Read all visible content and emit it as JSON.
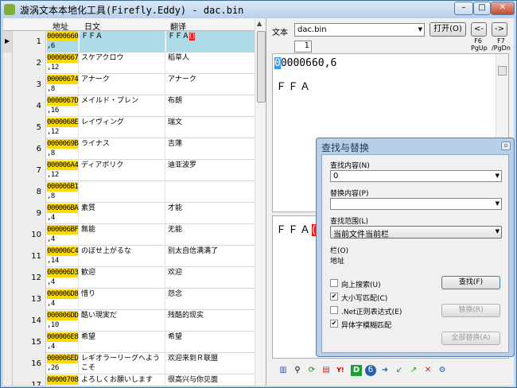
{
  "window": {
    "title": "漩涡文本本地化工具(Firefly.Eddy) - dac.bin",
    "minimize": "–",
    "maximize": "□",
    "close": "✕"
  },
  "grid": {
    "headers": {
      "address": "地址",
      "japanese": "日文",
      "translation": "翻译"
    },
    "rows": [
      {
        "num": "1",
        "addr": "00000660",
        "len": ",6",
        "jp": "ＦＦＡ",
        "cn": "ＦＦＡ",
        "cn_hl": "()"
      },
      {
        "num": "2",
        "addr": "00000667",
        "len": ",12",
        "jp": "スケアクロウ",
        "cn": "稻草人",
        "cn_hl": ""
      },
      {
        "num": "3",
        "addr": "00000674",
        "len": ",8",
        "jp": "アナーク",
        "cn": "アナーク",
        "cn_hl": ""
      },
      {
        "num": "4",
        "addr": "0000067D",
        "len": ",16",
        "jp": "メイルド・プレン",
        "cn": "布朗",
        "cn_hl": ""
      },
      {
        "num": "5",
        "addr": "0000068E",
        "len": ",12",
        "jp": "レイヴィング",
        "cn": "瑞文",
        "cn_hl": ""
      },
      {
        "num": "6",
        "addr": "0000069B",
        "len": ",8",
        "jp": "ライナス",
        "cn": "吉蓮",
        "cn_hl": ""
      },
      {
        "num": "7",
        "addr": "000006A4",
        "len": ",12",
        "jp": "ディアボリク",
        "cn": "迪亚波罗",
        "cn_hl": ""
      },
      {
        "num": "8",
        "addr": "000006B1",
        "len": ",8",
        "jp": "",
        "cn": "",
        "cn_hl": ""
      },
      {
        "num": "9",
        "addr": "000006BA",
        "len": ",4",
        "jp": "素質",
        "cn": "才能",
        "cn_hl": ""
      },
      {
        "num": "10",
        "addr": "000006BF",
        "len": ",4",
        "jp": "無能",
        "cn": "无能",
        "cn_hl": ""
      },
      {
        "num": "11",
        "addr": "000006C4",
        "len": ",14",
        "jp": "のぼせ上がるな",
        "cn": "别太自信满满了",
        "cn_hl": ""
      },
      {
        "num": "12",
        "addr": "000006D3",
        "len": ",4",
        "jp": "歓迎",
        "cn": "欢迎",
        "cn_hl": ""
      },
      {
        "num": "13",
        "addr": "000006D8",
        "len": ",4",
        "jp": "惜り",
        "cn": "怨念",
        "cn_hl": ""
      },
      {
        "num": "14",
        "addr": "000006DD",
        "len": ",10",
        "jp": "酷い現実だ",
        "cn": "残酷的现实",
        "cn_hl": ""
      },
      {
        "num": "15",
        "addr": "000006E8",
        "len": ",4",
        "jp": "希望",
        "cn": "希望",
        "cn_hl": ""
      },
      {
        "num": "16",
        "addr": "000006ED",
        "len": ",26",
        "jp": "レギオラーリーグへようこそ",
        "cn": "欢迎来到Ｒ联盟",
        "cn_hl": ""
      },
      {
        "num": "17",
        "addr": "00000708",
        "len": "",
        "jp": "よろしくお願いします",
        "cn": "很高兴与你见面",
        "cn_hl": ""
      }
    ]
  },
  "right": {
    "text_label": "文本",
    "file_combo": "dac.bin",
    "open_button": "打开(O)",
    "prev_button": "<-",
    "next_button": "->",
    "f6_label": "F6\nPgUp",
    "f7_label": "F7\n/PgDn",
    "spin_value": "1",
    "address_cursor": "0",
    "address_rest": "0000660,6",
    "japanese_text": "ＦＦＡ",
    "translation_text": "ＦＦＡ",
    "translation_hl": "("
  },
  "dialog": {
    "title": "查找与替换",
    "find_label": "查找内容(N)",
    "find_value": "0",
    "replace_label": "替换内容(P)",
    "replace_value": "",
    "scope_label": "查找范围(L)",
    "scope_value": "当前文件当前栏",
    "column_label": "栏(O)",
    "column_value": "地址",
    "search_up": "向上搜索(U)",
    "match_case": "大小写匹配(C)",
    "regex": ".Net正则表达式(E)",
    "variant_fuzzy": "异体字模糊匹配",
    "find_button": "查找(F)",
    "replace_button": "替换(R)",
    "replace_all_button": "全部替换(A)",
    "search_up_checked": false,
    "match_case_checked": true,
    "regex_checked": false,
    "variant_fuzzy_checked": true
  },
  "colors": {
    "address_highlight": "#ffd800",
    "selected_row": "#aedbe8",
    "mark_red": "#ff1010"
  }
}
